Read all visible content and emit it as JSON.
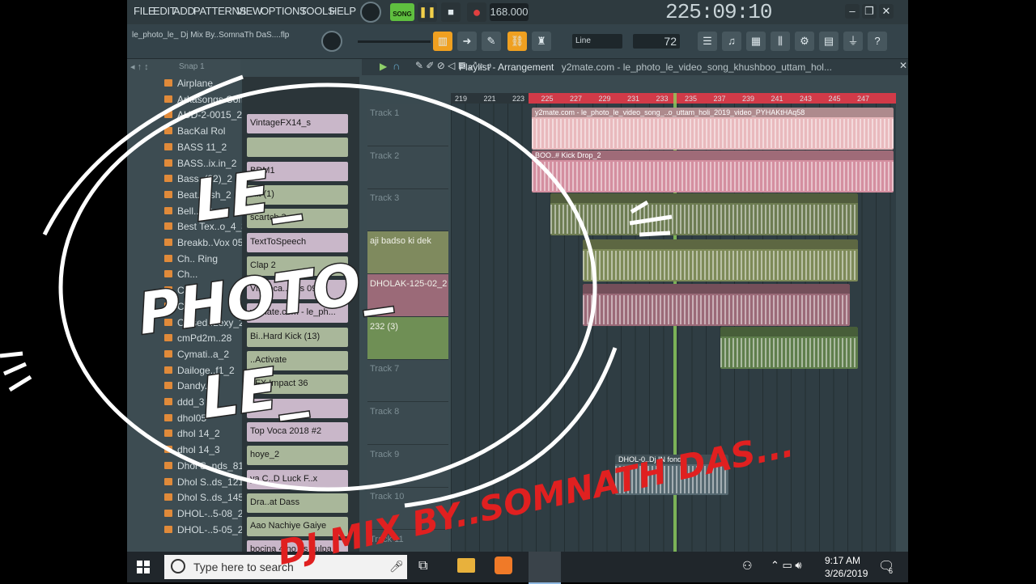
{
  "menu": [
    "FILE",
    "EDIT",
    "ADD",
    "PATTERNS",
    "VIEW",
    "OPTIONS",
    "TOOLS",
    "HELP"
  ],
  "transport": {
    "song_label": "SONG",
    "tempo": "168.000",
    "clock": "225:09:10"
  },
  "project": {
    "pattern_name": "le_photo_le_ Dj Mix  By..SomnaTh DaS....flp",
    "line_mode": "Line",
    "step_value": "72"
  },
  "browser": {
    "snap_label": "Snap 1",
    "items": [
      "Airplane",
      "Arkasongs.Com",
      "AUD-2-0015_2",
      "BacKal Rol",
      "BASS 11_2",
      "BASS..ix.in_2",
      "Bass..(22)_2",
      "Beat..nish_2",
      "Bell..._2",
      "Best Tex..o_4_3",
      "Breakb..Vox 05",
      "Ch.. Ring",
      "Ch...",
      "Ch...",
      "Ch...",
      "Closed..Lexy_2",
      "cmPd2m..28",
      "Cymati..a_2",
      "Dailoge..f1_2",
      "Dandy..",
      "ddd_3",
      "dhol05",
      "dhol 14_2",
      "dhol 14_3",
      "Dhol S..nds_81",
      "Dhol S..ds_121",
      "Dhol S..ds_145",
      "DHOL-..5-08_2",
      "DHOL-..5-05_2"
    ]
  },
  "channels": [
    "VintageFX14_s",
    "",
    "BDM1",
    "Hit (1)",
    "scartch 3",
    "TextToSpeech",
    "Clap 2",
    "Vi..Voca..hots 09",
    "y2mate.com - le_ph...",
    "Bi..Hard Kick (13)",
    "..Activate",
    "..FX Impact 36",
    "..",
    "Top Voca 2018 #2",
    "hoye_2",
    "ya C..D Luck F..x",
    "Dra..at Dass",
    "Aao Nachiye Gaiye",
    "bocina 4 no es culpa"
  ],
  "playlist": {
    "title": "Playlist - Arrangement",
    "file": "y2mate.com - le_photo_le_video_song_khushboo_uttam_hol...",
    "ruler": [
      "219",
      "221",
      "223",
      "225",
      "227",
      "229",
      "231",
      "233",
      "235",
      "237",
      "239",
      "241",
      "243",
      "245",
      "247"
    ],
    "tracks": [
      "Track 1",
      "Track 2",
      "Track 3",
      "aji badso ki dek",
      "DHOLAK-125-02_2",
      "232 (3)",
      "Track 7",
      "Track 8",
      "Track 9",
      "Track 10",
      "Track 11"
    ],
    "clips": [
      {
        "label": "y2mate.com - le_photo_le_video_song_..o_uttam_holi_2019_video_PYHAKtHAq58",
        "color": "#e9b9bd"
      },
      {
        "label": "BOO..# Kick Drop_2",
        "color": "#d48fa0"
      },
      {
        "label": "",
        "color": "#6d7c52"
      },
      {
        "label": "",
        "color": "#7d8a58"
      },
      {
        "label": "",
        "color": "#9b6a78"
      },
      {
        "label": "",
        "color": "#5f7e4c"
      },
      {
        "label": "DHOL-0..Dj IN  fonda",
        "color": "#556870"
      }
    ]
  },
  "overlay": {
    "title_lines": [
      "LE_",
      "PHOTO_",
      "LE_"
    ],
    "subtitle": "DJ MIX  BY..SOMNATH DAS..."
  },
  "taskbar": {
    "search_placeholder": "Type here to search",
    "time": "9:17 AM",
    "date": "3/26/2019",
    "notification_count": "6"
  },
  "colors": {
    "accent_green": "#5fbf3f",
    "ruler_red": "#d23a48",
    "overlay_red": "#e02020"
  }
}
